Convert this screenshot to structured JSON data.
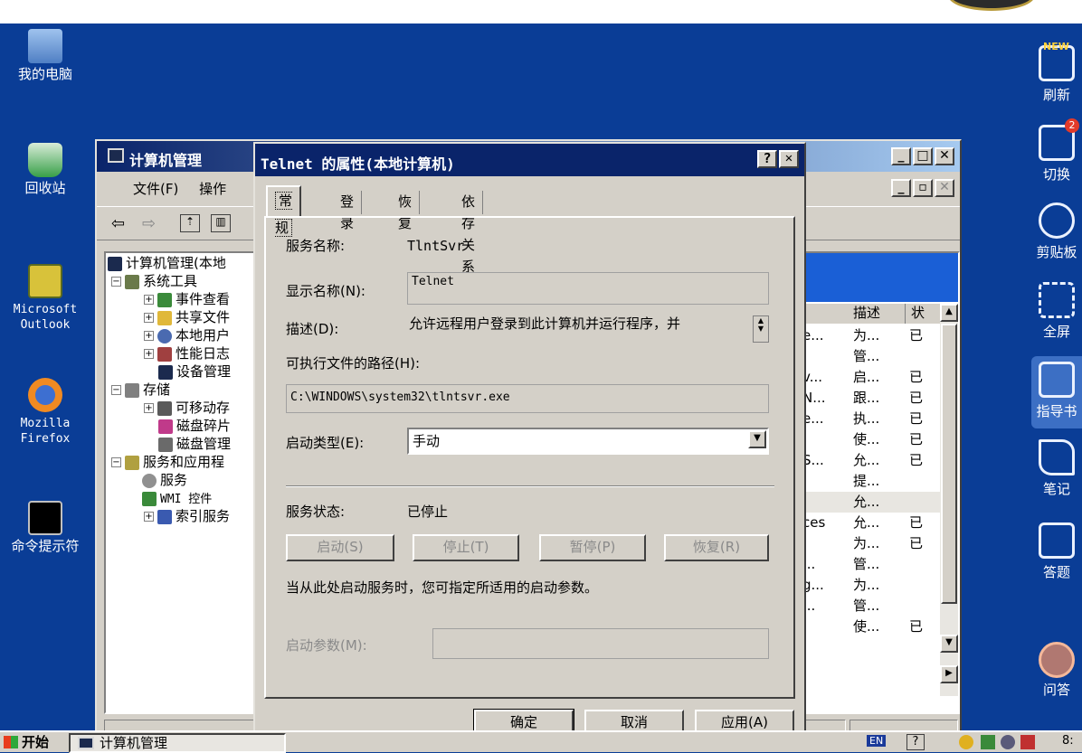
{
  "desktop_icons": [
    {
      "label": "我的电脑"
    },
    {
      "label": "回收站"
    },
    {
      "label": "Microsoft\nOutlook"
    },
    {
      "label": "Mozilla\nFirefox"
    },
    {
      "label": "命令提示符"
    }
  ],
  "right_toolbar": {
    "items": [
      {
        "label": "刷新",
        "badge": "NEW"
      },
      {
        "label": "切换",
        "badge": "2"
      },
      {
        "label": "剪贴板"
      },
      {
        "label": "全屏"
      },
      {
        "label": "指导书"
      },
      {
        "label": "笔记"
      },
      {
        "label": "答题"
      },
      {
        "label": "问答"
      }
    ]
  },
  "mgmt_window": {
    "title": "计算机管理",
    "menu": {
      "file": "文件(F)",
      "action": "操作"
    },
    "tree": [
      {
        "label": "计算机管理(本地",
        "indent": 0,
        "exp": ""
      },
      {
        "label": "系统工具",
        "indent": 1,
        "exp": "−"
      },
      {
        "label": "事件查看",
        "indent": 2,
        "exp": "+"
      },
      {
        "label": "共享文件",
        "indent": 2,
        "exp": "+"
      },
      {
        "label": "本地用户",
        "indent": 2,
        "exp": "+"
      },
      {
        "label": "性能日志",
        "indent": 2,
        "exp": "+"
      },
      {
        "label": "设备管理",
        "indent": 2,
        "exp": ""
      },
      {
        "label": "存储",
        "indent": 1,
        "exp": "−"
      },
      {
        "label": "可移动存",
        "indent": 2,
        "exp": "+"
      },
      {
        "label": "磁盘碎片",
        "indent": 2,
        "exp": ""
      },
      {
        "label": "磁盘管理",
        "indent": 2,
        "exp": ""
      },
      {
        "label": "服务和应用程",
        "indent": 1,
        "exp": "−"
      },
      {
        "label": "服务",
        "indent": 2,
        "exp": ""
      },
      {
        "label": "WMI 控件",
        "indent": 2,
        "exp": ""
      },
      {
        "label": "索引服务",
        "indent": 2,
        "exp": "+"
      }
    ],
    "list_columns": {
      "desc": "描述",
      "status": "状"
    },
    "list_rows": [
      {
        "a": "e...",
        "desc": "为...",
        "status": "已"
      },
      {
        "a": "",
        "desc": "管...",
        "status": ""
      },
      {
        "a": "v...",
        "desc": "启...",
        "status": "已"
      },
      {
        "a": "N...",
        "desc": "跟...",
        "status": "已"
      },
      {
        "a": "e...",
        "desc": "执...",
        "status": "已"
      },
      {
        "a": "",
        "desc": "使...",
        "status": "已"
      },
      {
        "a": "S...",
        "desc": "允...",
        "status": "已"
      },
      {
        "a": "",
        "desc": "提...",
        "status": ""
      },
      {
        "a": "",
        "desc": "允...",
        "status": ""
      },
      {
        "a": "ces",
        "desc": "允...",
        "status": "已"
      },
      {
        "a": "",
        "desc": "为...",
        "status": "已"
      },
      {
        "a": "...",
        "desc": "管...",
        "status": ""
      },
      {
        "a": "g...",
        "desc": "为...",
        "status": ""
      },
      {
        "a": "...",
        "desc": "管...",
        "status": ""
      },
      {
        "a": "",
        "desc": "使...",
        "status": "已"
      }
    ]
  },
  "dialog": {
    "title": "Telnet 的属性(本地计算机)",
    "tabs": [
      "常规",
      "登录",
      "恢复",
      "依存关系"
    ],
    "service_name_label": "服务名称:",
    "service_name": "TlntSvr",
    "display_name_label": "显示名称(N):",
    "display_name": "Telnet",
    "description_label": "描述(D):",
    "description": "允许远程用户登录到此计算机并运行程序，并",
    "path_label": "可执行文件的路径(H):",
    "path": "C:\\WINDOWS\\system32\\tlntsvr.exe",
    "startup_type_label": "启动类型(E):",
    "startup_type": "手动",
    "service_status_label": "服务状态:",
    "service_status": "已停止",
    "buttons": {
      "start": "启动(S)",
      "stop": "停止(T)",
      "pause": "暂停(P)",
      "resume": "恢复(R)"
    },
    "hint": "当从此处启动服务时，您可指定所适用的启动参数。",
    "start_params_label": "启动参数(M):",
    "start_params": "",
    "footer": {
      "ok": "确定",
      "cancel": "取消",
      "apply": "应用(A)"
    }
  },
  "taskbar": {
    "start": "开始",
    "task": "计算机管理",
    "tray_lang": "EN",
    "tray_clock": "8:"
  },
  "colors": {
    "desktop": "#0a3d96",
    "titlebar_active": "#0a246a",
    "face": "#d4d0c8"
  }
}
